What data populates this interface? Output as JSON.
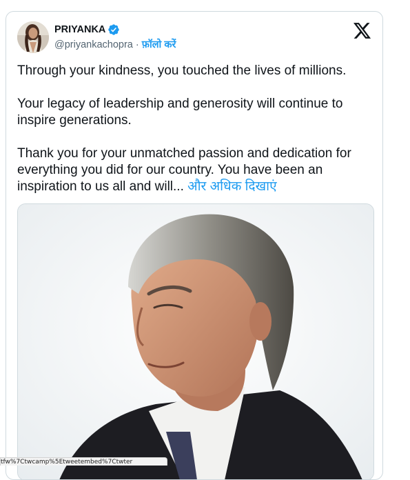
{
  "tweet": {
    "author_name": "PRIYANKA",
    "handle": "@priyankachopra",
    "separator": " · ",
    "follow_label": "फ़ॉलो करें",
    "verified_icon": "verified-badge-icon",
    "brand_icon": "x-logo-icon",
    "paragraphs": [
      "Through your kindness, you touched the lives of millions.",
      "Your legacy of leadership and generosity will continue to inspire generations.",
      "Thank you for your unmatched passion and dedication for everything you did for our country. You have been an inspiration to us all and will..."
    ],
    "show_more_label": " और अधिक दिखाएं",
    "media_description": "photo"
  },
  "browser": {
    "status_url": "tfw%7Ctwcamp%5Etweetembed%7Ctwter"
  },
  "colors": {
    "link": "#1d9bf0",
    "text": "#0f1419",
    "secondary": "#536471",
    "border": "#cfd9de"
  }
}
